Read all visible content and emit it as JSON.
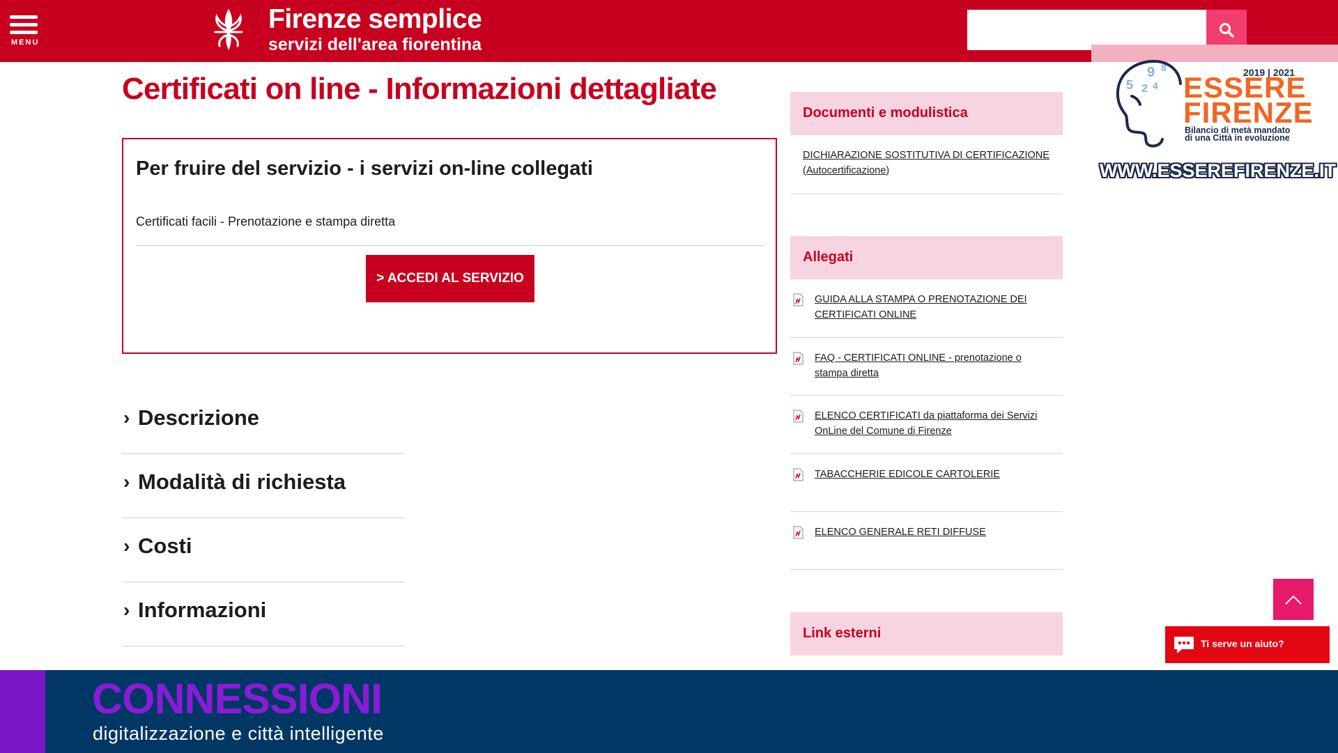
{
  "header": {
    "menu_label": "MENU",
    "brand_title": "Firenze semplice",
    "brand_subtitle": "servizi dell'area fiorentina",
    "search_placeholder": "",
    "accent_color": "#c8001f"
  },
  "page": {
    "title": "Certificati on line - Informazioni dettagliate"
  },
  "service_box": {
    "heading": "Per fruire del servizio - i servizi on-line collegati",
    "service_name": "Certificati facili - Prenotazione e stampa diretta",
    "button_label": "> ACCEDI AL SERVIZIO"
  },
  "accordion": [
    {
      "label": "Descrizione"
    },
    {
      "label": "Modalità di richiesta"
    },
    {
      "label": "Costi"
    },
    {
      "label": "Informazioni"
    }
  ],
  "sidebar": {
    "documents": {
      "heading": "Documenti e modulistica",
      "items": [
        {
          "label": "DICHIARAZIONE SOSTITUTIVA DI CERTIFICAZIONE (Autocertificazione)"
        }
      ]
    },
    "attachments": {
      "heading": "Allegati",
      "icon": "pdf-icon",
      "items": [
        {
          "label": "GUIDA ALLA STAMPA O PRENOTAZIONE DEI CERTIFICATI ONLINE"
        },
        {
          "label": "FAQ - CERTIFICATI ONLINE - prenotazione o stampa diretta"
        },
        {
          "label": "ELENCO CERTIFICATI da piattaforma dei Servizi OnLine del Comune di Firenze"
        },
        {
          "label": "TABACCHERIE EDICOLE CARTOLERIE"
        },
        {
          "label": "ELENCO GENERALE RETI DIFFUSE"
        }
      ]
    },
    "external": {
      "heading": "Link esterni"
    }
  },
  "overlay_logo": {
    "years": "2019 | 2021",
    "title_line1": "ESSERE",
    "title_line2": "FIRENZE",
    "subtitle_line1": "Bilancio di metà mandato",
    "subtitle_line2": "di una Città in evoluzione",
    "url": "WWW.ESSEREFIRENZE.IT"
  },
  "chat": {
    "label": "Ti serve un aiuto?"
  },
  "banner": {
    "title": "CONNESSIONI",
    "subtitle": "digitalizzazione e città intelligente"
  }
}
